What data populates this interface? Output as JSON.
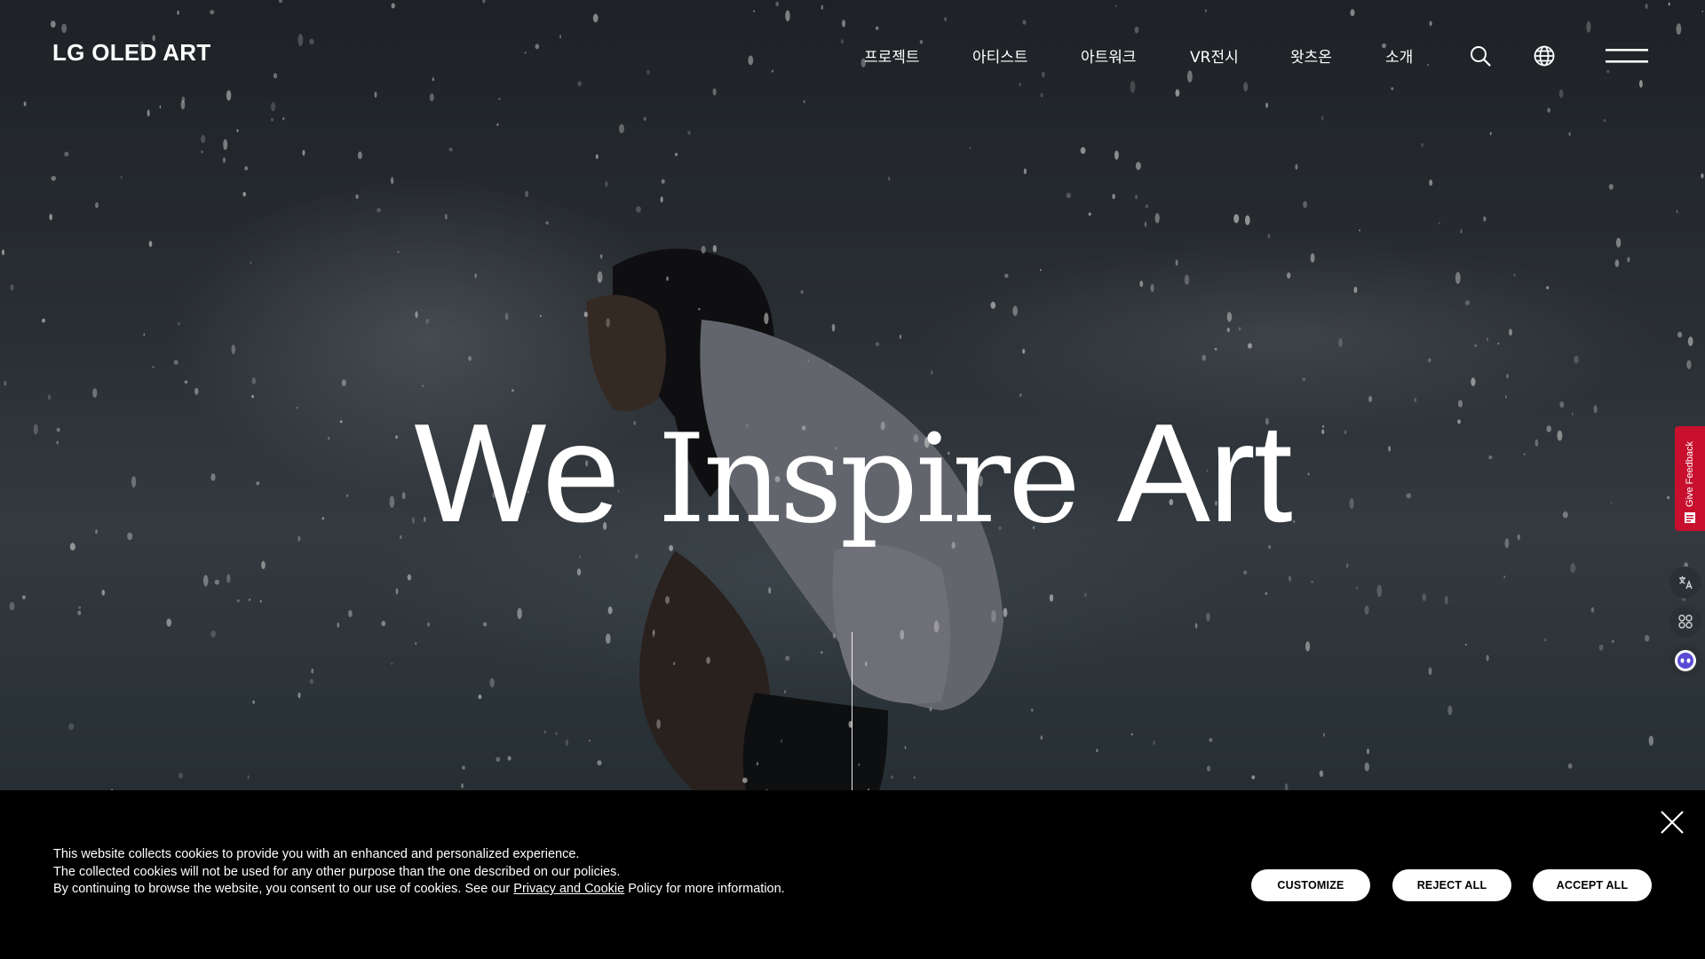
{
  "header": {
    "logo": "LG OLED ART",
    "nav": [
      {
        "label": "프로젝트"
      },
      {
        "label": "아티스트"
      },
      {
        "label": "아트워크"
      },
      {
        "label": "VR전시"
      },
      {
        "label": "왓츠온"
      },
      {
        "label": "소개"
      }
    ],
    "icons": [
      "search-icon",
      "globe-icon",
      "hamburger-menu-icon"
    ]
  },
  "hero": {
    "headline_word1": "We",
    "headline_word2": "Inspire",
    "headline_word3": "Art"
  },
  "side_widgets": {
    "feedback_label": "Give Feedback",
    "buttons": [
      "translate-icon",
      "apps-icon",
      "assistant-bot-icon"
    ],
    "feedback_color": "#c8102e"
  },
  "cookie_banner": {
    "line1": "This website collects cookies to provide you with an enhanced and personalized experience.",
    "line2": "The collected cookies will not be used for any other purpose than the one described on our policies.",
    "line3_before": "By continuing to browse the website, you consent to our use of cookies. See our ",
    "line3_link": "Privacy and Cookie",
    "line3_after": " Policy for more information.",
    "customize_label": "CUSTOMIZE",
    "reject_label": "REJECT ALL",
    "accept_label": "ACCEPT ALL"
  },
  "colors": {
    "banner_bg": "#000000",
    "text": "#ffffff",
    "accent": "#c8102e"
  }
}
